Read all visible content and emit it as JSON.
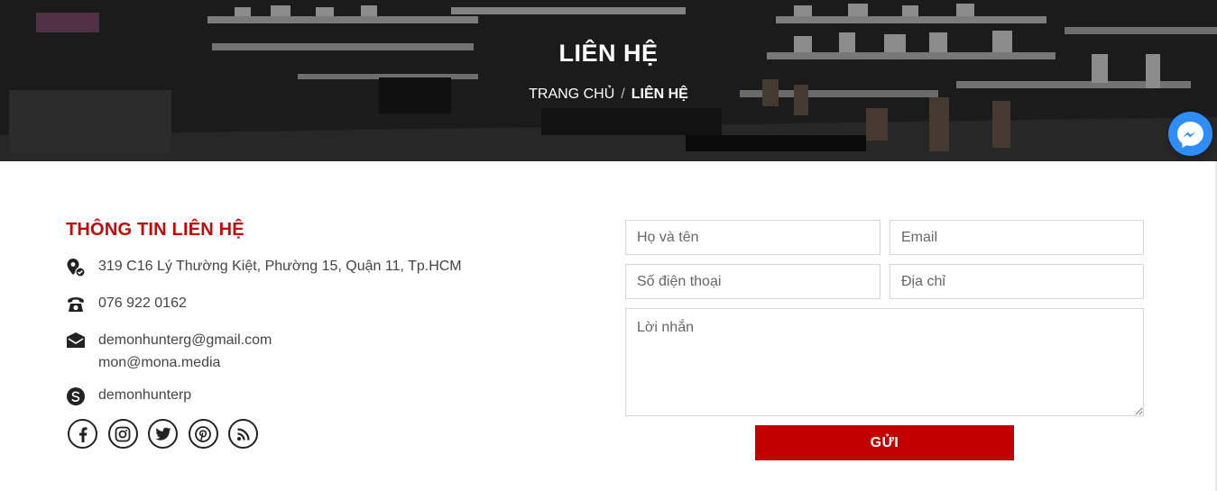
{
  "hero": {
    "title": "LIÊN HỆ",
    "breadcrumb": {
      "home": "TRANG CHỦ",
      "separator": "/",
      "current": "LIÊN HỆ"
    }
  },
  "contact_info": {
    "heading": "THÔNG TIN LIÊN HỆ",
    "address": "319 C16 Lý Thường Kiệt, Phường 15, Quận 11, Tp.HCM",
    "phone": "076 922 0162",
    "email_1": "demonhunterg@gmail.com",
    "email_2": "mon@mona.media",
    "skype": "demonhunterp",
    "socials": [
      "facebook-icon",
      "instagram-icon",
      "twitter-icon",
      "pinterest-icon",
      "rss-icon"
    ]
  },
  "form": {
    "name_placeholder": "Họ và tên",
    "email_placeholder": "Email",
    "phone_placeholder": "Số điện thoại",
    "address_placeholder": "Địa chỉ",
    "message_placeholder": "Lời nhắn",
    "submit_label": "GỬI"
  },
  "colors": {
    "accent": "#c20a0a",
    "button": "#c20000",
    "messenger": "#2e8df6"
  }
}
